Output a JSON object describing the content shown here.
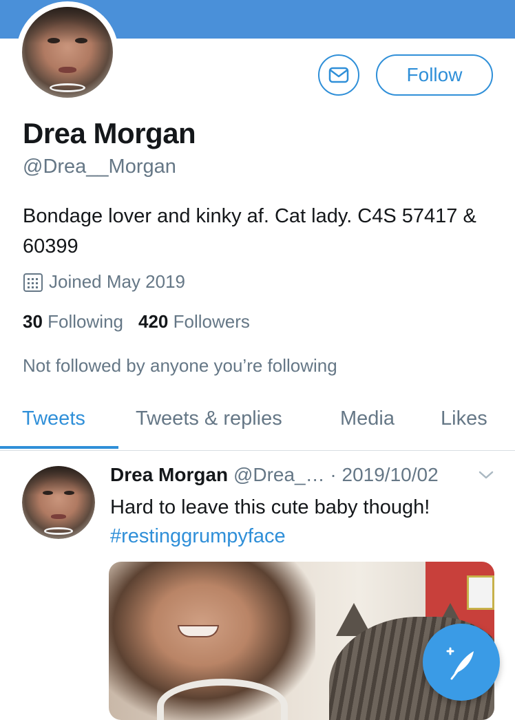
{
  "profile": {
    "name": "Drea Morgan",
    "handle": "@Drea__Morgan",
    "bio": "Bondage lover and kinky af. Cat lady. C4S 57417 & 60399",
    "joined": "Joined May 2019",
    "following_count": "30",
    "following_label": "Following",
    "followers_count": "420",
    "followers_label": "Followers",
    "not_followed_text": "Not followed by anyone you’re following"
  },
  "actions": {
    "follow_label": "Follow",
    "message_icon": "envelope-icon"
  },
  "tabs": [
    {
      "label": "Tweets",
      "active": true
    },
    {
      "label": "Tweets & replies",
      "active": false
    },
    {
      "label": "Media",
      "active": false
    },
    {
      "label": "Likes",
      "active": false
    }
  ],
  "tweet": {
    "author_name": "Drea Morgan",
    "author_handle": "@Drea_…",
    "separator": " · ",
    "date": "2019/10/02",
    "text": "Hard to leave this cute baby though!",
    "hashtag": "#restinggrumpyface"
  },
  "colors": {
    "accent": "#2f8fd8",
    "banner": "#4a90d9",
    "secondary_text": "#657786",
    "fab": "#3a9be6"
  }
}
